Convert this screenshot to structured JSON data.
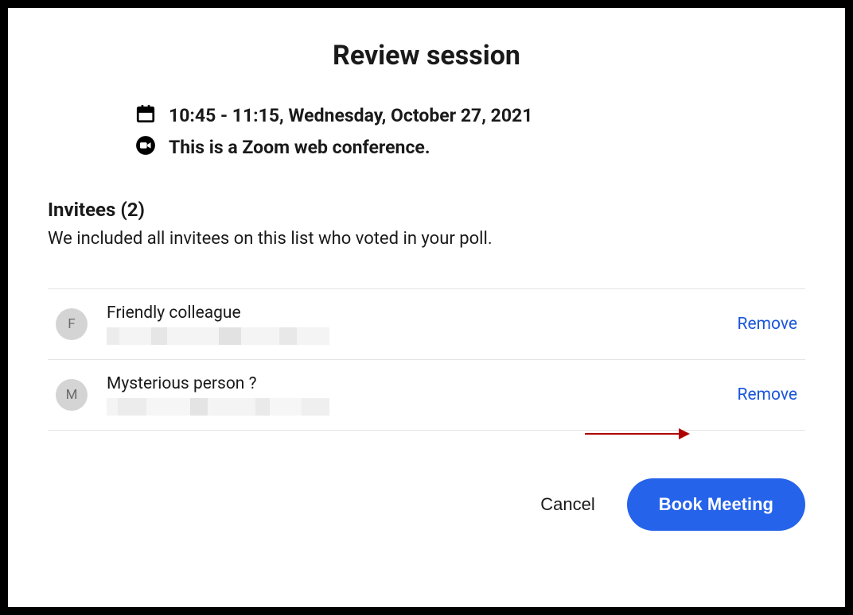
{
  "title": "Review session",
  "details": {
    "datetime": "10:45 - 11:15, Wednesday, October 27, 2021",
    "conference": "This is a Zoom web conference."
  },
  "invitees": {
    "header": "Invitees (2)",
    "subtext": "We included all invitees on this list who voted in your poll.",
    "list": [
      {
        "initial": "F",
        "name": "Friendly colleague",
        "remove": "Remove"
      },
      {
        "initial": "M",
        "name": "Mysterious person ?",
        "remove": "Remove"
      }
    ]
  },
  "actions": {
    "cancel": "Cancel",
    "book": "Book Meeting"
  },
  "colors": {
    "link": "#1a56db",
    "primary": "#2563eb",
    "arrow": "#b00000"
  }
}
